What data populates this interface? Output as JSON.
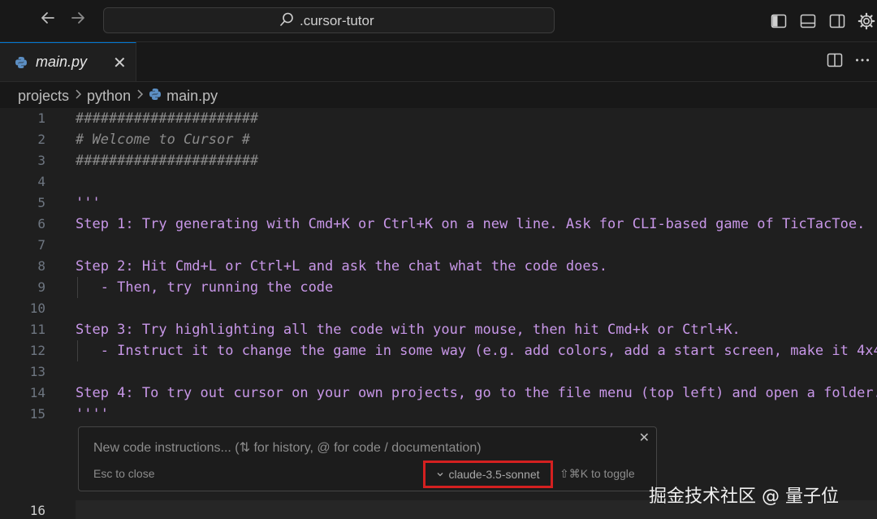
{
  "titlebar": {
    "search_text": ".cursor-tutor",
    "back_icon": "arrow-left-icon",
    "forward_icon": "arrow-right-icon"
  },
  "tab": {
    "filename": "main.py",
    "close_glyph": "✕"
  },
  "breadcrumb": {
    "items": [
      "projects",
      "python",
      "main.py"
    ]
  },
  "editor": {
    "lines": [
      {
        "n": "1",
        "text": "######################"
      },
      {
        "n": "2",
        "text": "# Welcome to Cursor #"
      },
      {
        "n": "3",
        "text": "######################"
      },
      {
        "n": "4",
        "text": ""
      },
      {
        "n": "5",
        "text": "'''"
      },
      {
        "n": "6",
        "text": "Step 1: Try generating with Cmd+K or Ctrl+K on a new line. Ask for CLI-based game of TicTacToe."
      },
      {
        "n": "7",
        "text": ""
      },
      {
        "n": "8",
        "text": "Step 2: Hit Cmd+L or Ctrl+L and ask the chat what the code does."
      },
      {
        "n": "9",
        "text": "   - Then, try running the code"
      },
      {
        "n": "10",
        "text": ""
      },
      {
        "n": "11",
        "text": "Step 3: Try highlighting all the code with your mouse, then hit Cmd+k or Ctrl+K."
      },
      {
        "n": "12",
        "text": "   - Instruct it to change the game in some way (e.g. add colors, add a start screen, make it 4x4"
      },
      {
        "n": "13",
        "text": ""
      },
      {
        "n": "14",
        "text": "Step 4: To try out cursor on your own projects, go to the file menu (top left) and open a folder."
      },
      {
        "n": "15",
        "text": "''''"
      },
      {
        "n": "16",
        "text": ""
      }
    ]
  },
  "prompt": {
    "placeholder": "New code instructions... (⇅ for history, @ for code / documentation)",
    "esc_hint": "Esc to close",
    "model": "claude-3.5-sonnet",
    "toggle_hint": "⇧⌘K to toggle",
    "close_glyph": "✕"
  },
  "watermark": "掘金技术社区 @ 量子位",
  "colors": {
    "accent": "#0078d4",
    "highlight_box": "#d42020",
    "string": "#c897e8",
    "comment": "#8b8b8b"
  }
}
